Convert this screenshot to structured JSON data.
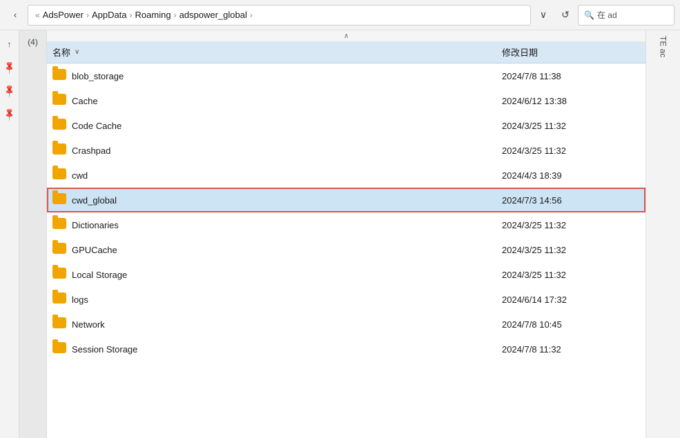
{
  "addressBar": {
    "backLabel": "‹",
    "breadcrumbs": [
      {
        "label": "AdsPower"
      },
      {
        "label": "AppData"
      },
      {
        "label": "Roaming"
      },
      {
        "label": "adspower_global"
      },
      {
        "label": ""
      }
    ],
    "dropdownIcon": "∨",
    "refreshIcon": "↺",
    "searchPlaceholder": "在 adspower_global 中搜索",
    "searchText": "在 ad"
  },
  "tableHeader": {
    "nameLabel": "名称",
    "sortIcon": "∨",
    "dateLabel": "修改日期"
  },
  "sortIndicator": "∧",
  "sidebar": {
    "upArrow": "↑",
    "downArrow": "↓",
    "pin1": "📌",
    "pin2": "📌",
    "pin3": "📌",
    "sideLabel": "(4)"
  },
  "files": [
    {
      "name": "blob_storage",
      "date": "2024/7/8 11:38",
      "selected": false,
      "highlighted": false
    },
    {
      "name": "Cache",
      "date": "2024/6/12 13:38",
      "selected": false,
      "highlighted": false
    },
    {
      "name": "Code Cache",
      "date": "2024/3/25 11:32",
      "selected": false,
      "highlighted": false
    },
    {
      "name": "Crashpad",
      "date": "2024/3/25 11:32",
      "selected": false,
      "highlighted": false
    },
    {
      "name": "cwd",
      "date": "2024/4/3 18:39",
      "selected": false,
      "highlighted": false
    },
    {
      "name": "cwd_global",
      "date": "2024/7/3 14:56",
      "selected": true,
      "highlighted": true
    },
    {
      "name": "Dictionaries",
      "date": "2024/3/25 11:32",
      "selected": false,
      "highlighted": false
    },
    {
      "name": "GPUCache",
      "date": "2024/3/25 11:32",
      "selected": false,
      "highlighted": false
    },
    {
      "name": "Local Storage",
      "date": "2024/3/25 11:32",
      "selected": false,
      "highlighted": false
    },
    {
      "name": "logs",
      "date": "2024/6/14 17:32",
      "selected": false,
      "highlighted": false
    },
    {
      "name": "Network",
      "date": "2024/7/8 10:45",
      "selected": false,
      "highlighted": false
    },
    {
      "name": "Session Storage",
      "date": "2024/7/8 11:32",
      "selected": false,
      "highlighted": false
    }
  ]
}
